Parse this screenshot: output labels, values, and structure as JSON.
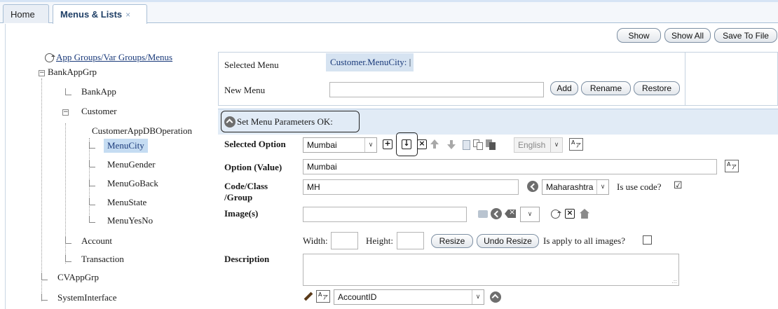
{
  "tabs": [
    {
      "label": "Home"
    },
    {
      "label": "Menus & Lists",
      "close": "×"
    }
  ],
  "toolbar": {
    "show": "Show",
    "show_all": "Show All",
    "save_to_file": "Save To File"
  },
  "tree": {
    "root": "App Groups/Var Groups/Menus",
    "bankappgrp": "BankAppGrp",
    "bankapp": "BankApp",
    "customer": "Customer",
    "customer_db_op": "CustomerAppDBOperation",
    "menu_city": "MenuCity",
    "menu_gender": "MenuGender",
    "menu_goback": "MenuGoBack",
    "menu_state": "MenuState",
    "menu_yesno": "MenuYesNo",
    "account": "Account",
    "transaction": "Transaction",
    "cvappgrp": "CVAppGrp",
    "system_interface": "SystemInterface",
    "expand_minus": "−"
  },
  "menu_box": {
    "selected_menu_label": "Selected Menu",
    "selected_menu_value": "Customer.MenuCity:",
    "new_menu_label": "New Menu",
    "new_menu_value": "",
    "add": "Add",
    "rename": "Rename",
    "restore": "Restore"
  },
  "params": {
    "section_title": "Set Menu Parameters",
    "section_status": "OK:",
    "selected_option_label": "Selected Option",
    "selected_option_value": "Mumbai",
    "language_value": "English",
    "option_value_label": "Option (Value)",
    "option_value": "Mumbai",
    "code_class_label_line1": "Code/Class",
    "code_class_label_line2": "/Group",
    "code_value": "MH",
    "group_select_value": "Maharashtra",
    "is_use_code_label": "Is use code?",
    "is_use_code_checked": "☑",
    "images_label": "Image(s)",
    "image_value": "",
    "image_select_value": "",
    "width_label": "Width:",
    "height_label": "Height:",
    "width_value": "",
    "height_value": "",
    "resize": "Resize",
    "undo_resize": "Undo Resize",
    "apply_all_label": "Is apply to all images?",
    "description_label": "Description",
    "description_value": "",
    "field_select_value": "AccountID"
  },
  "icons": {
    "plus": "+",
    "insert": "↓",
    "delete": "×",
    "clear": "×",
    "chevron": "∨",
    "translate_a": "A",
    "translate_b": "ア",
    "grip": ".::"
  }
}
